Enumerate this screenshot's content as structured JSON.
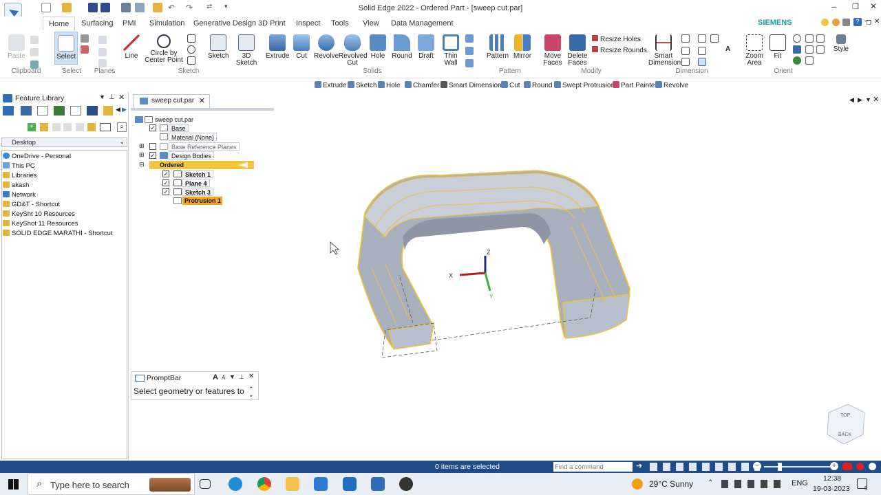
{
  "window": {
    "title": "Solid Edge 2022 - Ordered Part - [sweep cut.par]",
    "brand": "SIEMENS"
  },
  "tabs": [
    "Home",
    "Surfacing",
    "PMI",
    "Simulation",
    "Generative Design",
    "3D Print",
    "Inspect",
    "Tools",
    "View",
    "Data Management"
  ],
  "ribbon": {
    "paste": "Paste",
    "select": "Select",
    "line": "Line",
    "circle1": "Circle by",
    "circle2": "Center Point",
    "sketch": "Sketch",
    "sketch3d1": "3D",
    "sketch3d2": "Sketch",
    "extrude": "Extrude",
    "cut": "Cut",
    "revolve": "Revolve",
    "revcut1": "Revolved",
    "revcut2": "Cut",
    "hole": "Hole",
    "round": "Round",
    "draft": "Draft",
    "thin1": "Thin",
    "thin2": "Wall",
    "pattern": "Pattern",
    "mirror": "Mirror",
    "move1": "Move",
    "move2": "Faces",
    "delete1": "Delete",
    "delete2": "Faces",
    "resize_holes": "Resize Holes",
    "resize_rounds": "Resize Rounds",
    "smart1": "Smart",
    "smart2": "Dimension",
    "zoom1": "Zoom",
    "zoom2": "Area",
    "fit": "Fit",
    "style": "Style",
    "groups": {
      "clipboard": "Clipboard",
      "select": "Select",
      "planes": "Planes",
      "sketch": "Sketch",
      "solids": "Solids",
      "pattern": "Pattern",
      "modify": "Modify",
      "dimension": "Dimension",
      "orient": "Orient"
    }
  },
  "command_bar": [
    "Extrude",
    "Sketch",
    "Hole",
    "Chamfer",
    "Smart Dimension",
    "Cut",
    "Round",
    "Swept Protrusion",
    "Part Painter",
    "Revolve"
  ],
  "feature_library": {
    "title": "Feature Library",
    "location": "Desktop",
    "items": [
      "OneDrive - Personal",
      "This PC",
      "Libraries",
      "akash",
      "Network",
      "GD&T - Shortcut",
      "KeySht 10 Resources",
      "KeyShot 11 Resources",
      "SOLID EDGE MARATHI - Shortcut"
    ]
  },
  "doc_tab": "sweep cut.par",
  "tree": {
    "root": "sweep cut.par",
    "base": "Base",
    "material": "Material (None)",
    "ref_planes": "Base Reference Planes",
    "bodies": "Design Bodies",
    "ordered": "Ordered",
    "sketch1": "Sketch 1",
    "plane4": "Plane 4",
    "sketch3": "Sketch 3",
    "protrusion": "Protrusion 1"
  },
  "axes": {
    "x": "X",
    "y": "Y",
    "z": "Z"
  },
  "viewcube": {
    "top": "TOP",
    "back": "BACK"
  },
  "promptbar": {
    "title": "PromptBar",
    "text": "Select geometry or features to"
  },
  "status": {
    "selected": "0 items are selected",
    "find_placeholder": "Find a command"
  },
  "taskbar": {
    "search": "Type here to search",
    "weather": "29°C  Sunny",
    "lang": "ENG",
    "time": "12:38",
    "date": "19-03-2023",
    "notif": "5"
  },
  "colors": {
    "accent": "#1f4b88",
    "highlight": "#f5a623",
    "model": "#a8afbd",
    "edge": "#f0c23a"
  }
}
